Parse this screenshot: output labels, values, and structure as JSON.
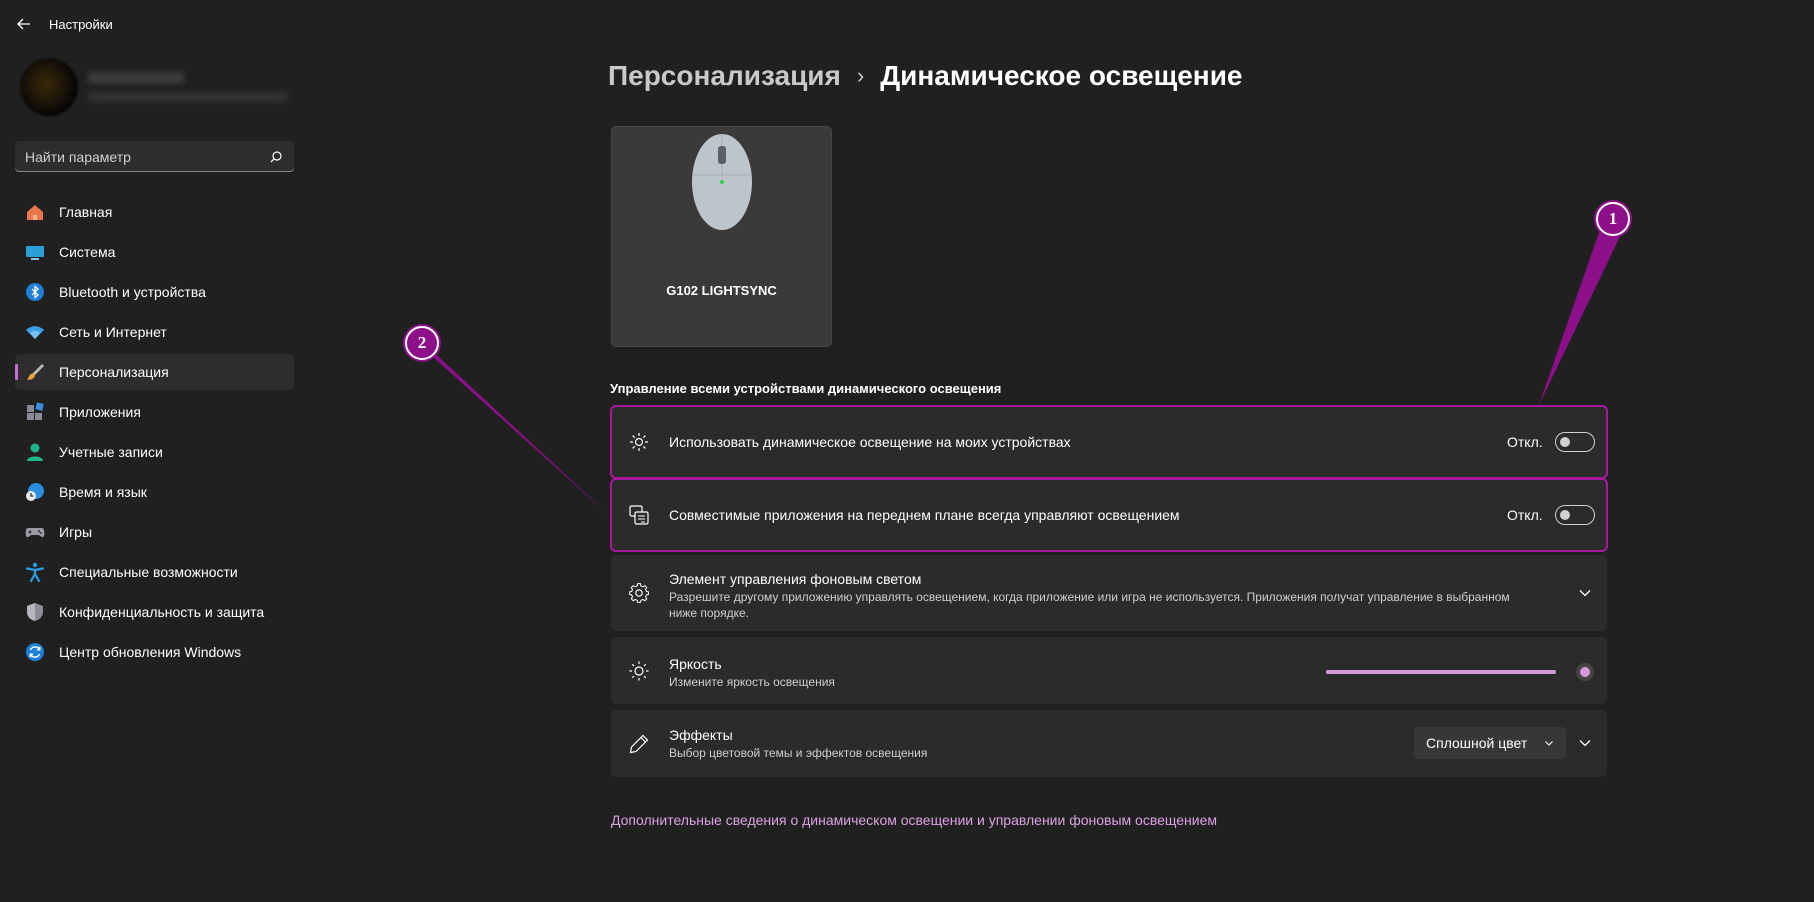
{
  "window": {
    "title": "Настройки"
  },
  "search": {
    "placeholder": "Найти параметр"
  },
  "sidebar": {
    "items": [
      {
        "label": "Главная",
        "icon": "home-icon"
      },
      {
        "label": "Система",
        "icon": "system-icon"
      },
      {
        "label": "Bluetooth и устройства",
        "icon": "bluetooth-icon"
      },
      {
        "label": "Сеть и Интернет",
        "icon": "wifi-icon"
      },
      {
        "label": "Персонализация",
        "icon": "brush-icon",
        "active": true
      },
      {
        "label": "Приложения",
        "icon": "apps-icon"
      },
      {
        "label": "Учетные записи",
        "icon": "account-icon"
      },
      {
        "label": "Время и язык",
        "icon": "time-language-icon"
      },
      {
        "label": "Игры",
        "icon": "gamepad-icon"
      },
      {
        "label": "Специальные возможности",
        "icon": "accessibility-icon"
      },
      {
        "label": "Конфиденциальность и защита",
        "icon": "shield-icon"
      },
      {
        "label": "Центр обновления Windows",
        "icon": "update-icon"
      }
    ]
  },
  "breadcrumb": {
    "parent": "Персонализация",
    "separator": "›",
    "current": "Динамическое освещение"
  },
  "device": {
    "name": "G102 LIGHTSYNC",
    "icon": "mouse-icon"
  },
  "section": {
    "title": "Управление всеми устройствами динамического освещения"
  },
  "settings": {
    "use_dynamic": {
      "title": "Использовать динамическое освещение на моих устройствах",
      "state": "Откл.",
      "on": false
    },
    "foreground_apps": {
      "title": "Совместимые приложения на переднем плане всегда управляют освещением",
      "state": "Откл.",
      "on": false
    },
    "background_control": {
      "title": "Элемент управления фоновым светом",
      "subtitle": "Разрешите другому приложению управлять освещением, когда приложение или игра не используется. Приложения получат управление в выбранном ниже порядке."
    },
    "brightness": {
      "title": "Яркость",
      "subtitle": "Измените яркость освещения",
      "value_fraction": 1.0
    },
    "effects": {
      "title": "Эффекты",
      "subtitle": "Выбор цветовой темы и эффектов освещения",
      "selected": "Сплошной цвет"
    }
  },
  "more_link": "Дополнительные сведения о динамическом освещении и управлении фоновым освещением",
  "callouts": {
    "first": "1",
    "second": "2"
  },
  "colors": {
    "accent": "#d49ad9",
    "callout": "#8e0f8a",
    "background": "#202020",
    "card": "#2b2b2b"
  }
}
